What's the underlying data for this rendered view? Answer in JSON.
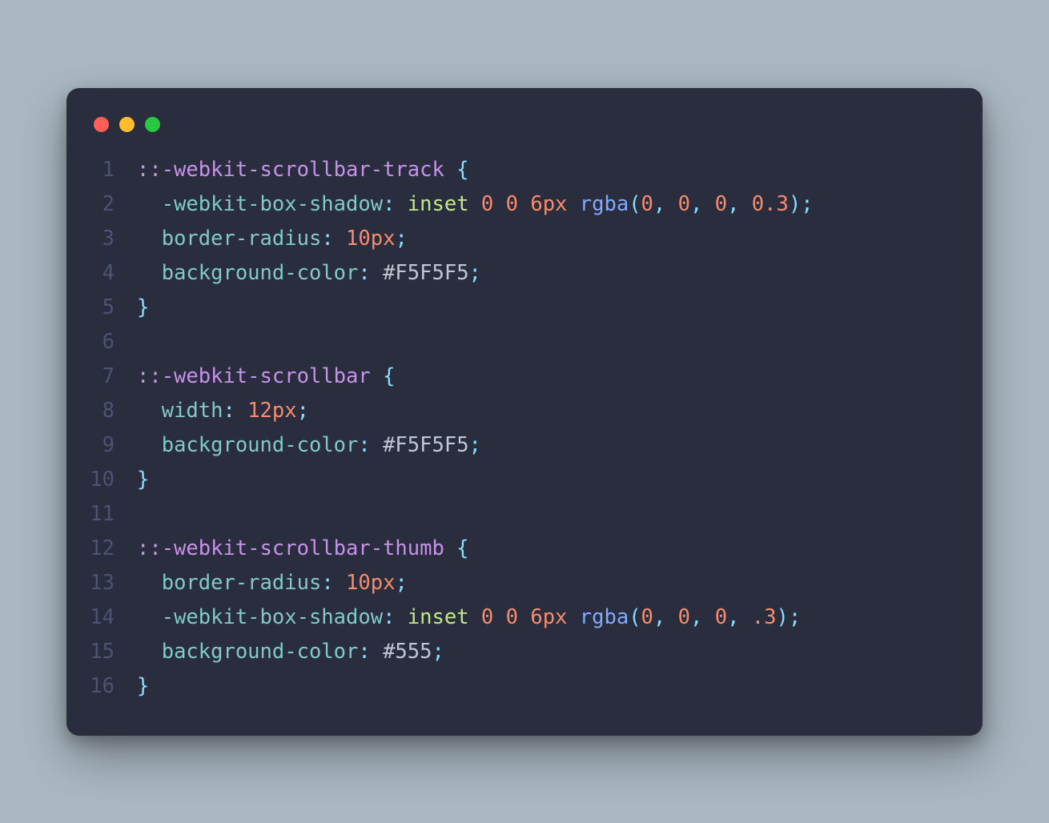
{
  "window": {
    "traffic_lights": [
      "red",
      "yellow",
      "green"
    ]
  },
  "code": {
    "lines": [
      {
        "n": "1",
        "tokens": [
          {
            "t": "::-webkit-scrollbar-track",
            "c": "tok-sel"
          },
          {
            "t": " ",
            "c": ""
          },
          {
            "t": "{",
            "c": "tok-punc"
          }
        ]
      },
      {
        "n": "2",
        "tokens": [
          {
            "t": "  ",
            "c": ""
          },
          {
            "t": "-webkit-box-shadow",
            "c": "tok-prop"
          },
          {
            "t": ":",
            "c": "tok-punc"
          },
          {
            "t": " ",
            "c": ""
          },
          {
            "t": "inset",
            "c": "tok-kw"
          },
          {
            "t": " ",
            "c": ""
          },
          {
            "t": "0",
            "c": "tok-num"
          },
          {
            "t": " ",
            "c": ""
          },
          {
            "t": "0",
            "c": "tok-num"
          },
          {
            "t": " ",
            "c": ""
          },
          {
            "t": "6px",
            "c": "tok-unit"
          },
          {
            "t": " ",
            "c": ""
          },
          {
            "t": "rgba",
            "c": "tok-func"
          },
          {
            "t": "(",
            "c": "tok-punc"
          },
          {
            "t": "0",
            "c": "tok-num"
          },
          {
            "t": ",",
            "c": "tok-punc"
          },
          {
            "t": " ",
            "c": ""
          },
          {
            "t": "0",
            "c": "tok-num"
          },
          {
            "t": ",",
            "c": "tok-punc"
          },
          {
            "t": " ",
            "c": ""
          },
          {
            "t": "0",
            "c": "tok-num"
          },
          {
            "t": ",",
            "c": "tok-punc"
          },
          {
            "t": " ",
            "c": ""
          },
          {
            "t": "0.3",
            "c": "tok-num"
          },
          {
            "t": ")",
            "c": "tok-punc"
          },
          {
            "t": ";",
            "c": "tok-punc"
          }
        ]
      },
      {
        "n": "3",
        "tokens": [
          {
            "t": "  ",
            "c": ""
          },
          {
            "t": "border-radius",
            "c": "tok-prop"
          },
          {
            "t": ":",
            "c": "tok-punc"
          },
          {
            "t": " ",
            "c": ""
          },
          {
            "t": "10px",
            "c": "tok-unit"
          },
          {
            "t": ";",
            "c": "tok-punc"
          }
        ]
      },
      {
        "n": "4",
        "tokens": [
          {
            "t": "  ",
            "c": ""
          },
          {
            "t": "background-color",
            "c": "tok-prop"
          },
          {
            "t": ":",
            "c": "tok-punc"
          },
          {
            "t": " ",
            "c": ""
          },
          {
            "t": "#F5F5F5",
            "c": "tok-val"
          },
          {
            "t": ";",
            "c": "tok-punc"
          }
        ]
      },
      {
        "n": "5",
        "tokens": [
          {
            "t": "}",
            "c": "tok-punc"
          }
        ]
      },
      {
        "n": "6",
        "tokens": [
          {
            "t": "",
            "c": ""
          }
        ]
      },
      {
        "n": "7",
        "tokens": [
          {
            "t": "::-webkit-scrollbar",
            "c": "tok-sel"
          },
          {
            "t": " ",
            "c": ""
          },
          {
            "t": "{",
            "c": "tok-punc"
          }
        ]
      },
      {
        "n": "8",
        "tokens": [
          {
            "t": "  ",
            "c": ""
          },
          {
            "t": "width",
            "c": "tok-prop"
          },
          {
            "t": ":",
            "c": "tok-punc"
          },
          {
            "t": " ",
            "c": ""
          },
          {
            "t": "12px",
            "c": "tok-unit"
          },
          {
            "t": ";",
            "c": "tok-punc"
          }
        ]
      },
      {
        "n": "9",
        "tokens": [
          {
            "t": "  ",
            "c": ""
          },
          {
            "t": "background-color",
            "c": "tok-prop"
          },
          {
            "t": ":",
            "c": "tok-punc"
          },
          {
            "t": " ",
            "c": ""
          },
          {
            "t": "#F5F5F5",
            "c": "tok-val"
          },
          {
            "t": ";",
            "c": "tok-punc"
          }
        ]
      },
      {
        "n": "10",
        "tokens": [
          {
            "t": "}",
            "c": "tok-punc"
          }
        ]
      },
      {
        "n": "11",
        "tokens": [
          {
            "t": "",
            "c": ""
          }
        ]
      },
      {
        "n": "12",
        "tokens": [
          {
            "t": "::-webkit-scrollbar-thumb",
            "c": "tok-sel"
          },
          {
            "t": " ",
            "c": ""
          },
          {
            "t": "{",
            "c": "tok-punc"
          }
        ]
      },
      {
        "n": "13",
        "tokens": [
          {
            "t": "  ",
            "c": ""
          },
          {
            "t": "border-radius",
            "c": "tok-prop"
          },
          {
            "t": ":",
            "c": "tok-punc"
          },
          {
            "t": " ",
            "c": ""
          },
          {
            "t": "10px",
            "c": "tok-unit"
          },
          {
            "t": ";",
            "c": "tok-punc"
          }
        ]
      },
      {
        "n": "14",
        "tokens": [
          {
            "t": "  ",
            "c": ""
          },
          {
            "t": "-webkit-box-shadow",
            "c": "tok-prop"
          },
          {
            "t": ":",
            "c": "tok-punc"
          },
          {
            "t": " ",
            "c": ""
          },
          {
            "t": "inset",
            "c": "tok-kw"
          },
          {
            "t": " ",
            "c": ""
          },
          {
            "t": "0",
            "c": "tok-num"
          },
          {
            "t": " ",
            "c": ""
          },
          {
            "t": "0",
            "c": "tok-num"
          },
          {
            "t": " ",
            "c": ""
          },
          {
            "t": "6px",
            "c": "tok-unit"
          },
          {
            "t": " ",
            "c": ""
          },
          {
            "t": "rgba",
            "c": "tok-func"
          },
          {
            "t": "(",
            "c": "tok-punc"
          },
          {
            "t": "0",
            "c": "tok-num"
          },
          {
            "t": ",",
            "c": "tok-punc"
          },
          {
            "t": " ",
            "c": ""
          },
          {
            "t": "0",
            "c": "tok-num"
          },
          {
            "t": ",",
            "c": "tok-punc"
          },
          {
            "t": " ",
            "c": ""
          },
          {
            "t": "0",
            "c": "tok-num"
          },
          {
            "t": ",",
            "c": "tok-punc"
          },
          {
            "t": " ",
            "c": ""
          },
          {
            "t": ".3",
            "c": "tok-num"
          },
          {
            "t": ")",
            "c": "tok-punc"
          },
          {
            "t": ";",
            "c": "tok-punc"
          }
        ]
      },
      {
        "n": "15",
        "tokens": [
          {
            "t": "  ",
            "c": ""
          },
          {
            "t": "background-color",
            "c": "tok-prop"
          },
          {
            "t": ":",
            "c": "tok-punc"
          },
          {
            "t": " ",
            "c": ""
          },
          {
            "t": "#555",
            "c": "tok-val"
          },
          {
            "t": ";",
            "c": "tok-punc"
          }
        ]
      },
      {
        "n": "16",
        "tokens": [
          {
            "t": "}",
            "c": "tok-punc"
          }
        ]
      }
    ]
  }
}
